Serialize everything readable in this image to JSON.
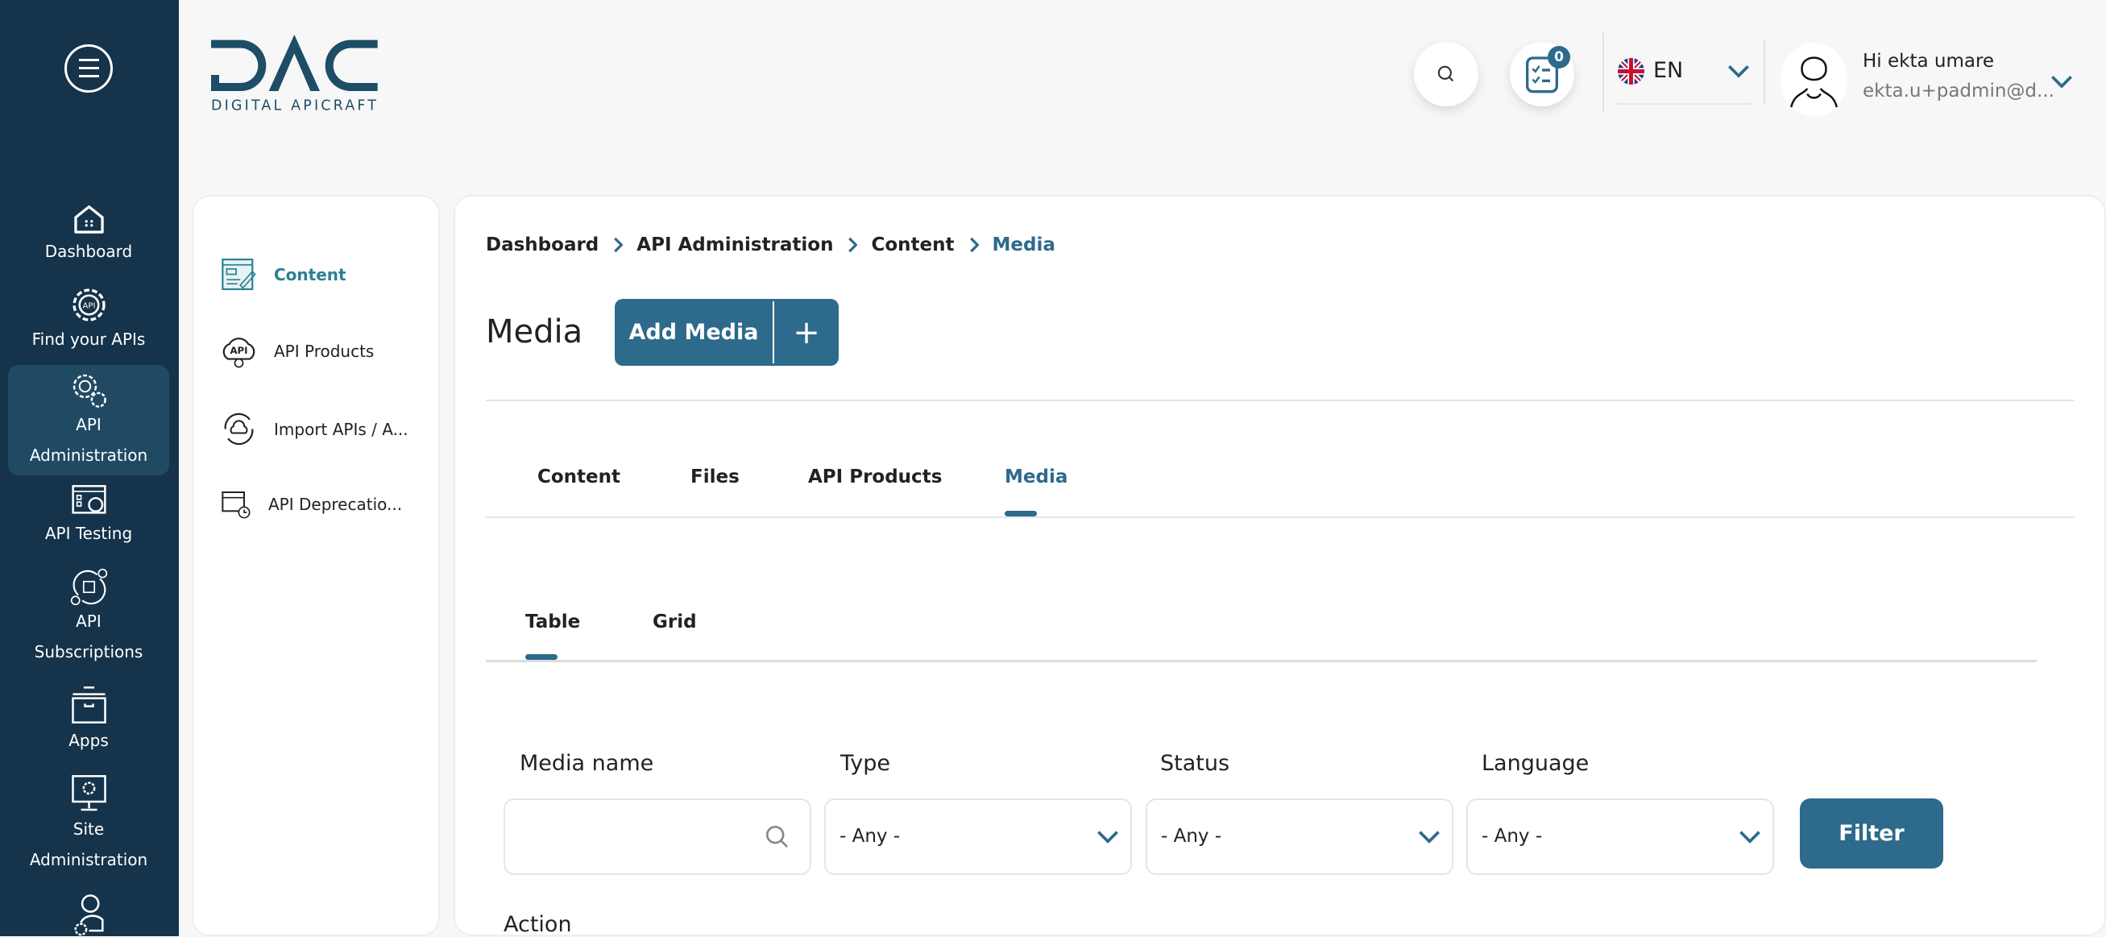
{
  "sidebar": {
    "items": [
      {
        "label": "Dashboard",
        "icon": "home-icon"
      },
      {
        "label": "Find your APIs",
        "icon": "api-gear-icon"
      },
      {
        "label1": "API",
        "label2": "Administration",
        "icon": "gears-icon",
        "active": true
      },
      {
        "label": "API Testing",
        "icon": "testing-icon"
      },
      {
        "label1": "API",
        "label2": "Subscriptions",
        "icon": "subscriptions-icon"
      },
      {
        "label": "Apps",
        "icon": "box-icon"
      },
      {
        "label1": "Site",
        "label2": "Administration",
        "icon": "monitor-gear-icon"
      }
    ]
  },
  "logo": {
    "text": "DAC",
    "subtitle": "DIGITAL APICRAFT"
  },
  "header": {
    "task_count": "0",
    "language": "EN",
    "greeting": "Hi ekta umare",
    "email": "ekta.u+padmin@d..."
  },
  "subnav": {
    "items": [
      {
        "label": "Content"
      },
      {
        "label": "API Products"
      },
      {
        "label": "Import APIs / A..."
      },
      {
        "label": "API Deprecatio..."
      }
    ]
  },
  "breadcrumb": [
    "Dashboard",
    "API Administration",
    "Content",
    "Media"
  ],
  "page": {
    "title": "Media",
    "add_label": "Add Media",
    "add_icon": "+"
  },
  "tabs": [
    {
      "label": "Content"
    },
    {
      "label": "Files"
    },
    {
      "label": "API Products"
    },
    {
      "label": "Media",
      "active": true
    }
  ],
  "view_tabs": [
    {
      "label": "Table",
      "active": true
    },
    {
      "label": "Grid"
    }
  ],
  "filters": {
    "media_name": {
      "label": "Media name",
      "value": "",
      "placeholder": ""
    },
    "type": {
      "label": "Type",
      "value": "- Any -"
    },
    "status": {
      "label": "Status",
      "value": "- Any -"
    },
    "language": {
      "label": "Language",
      "value": "- Any -"
    },
    "filter_label": "Filter",
    "action_label": "Action"
  },
  "colors": {
    "sidebar": "#15334a",
    "sidebar_active": "#204a64",
    "accent": "#2d6a8c",
    "sub_active": "#2d7f95"
  }
}
